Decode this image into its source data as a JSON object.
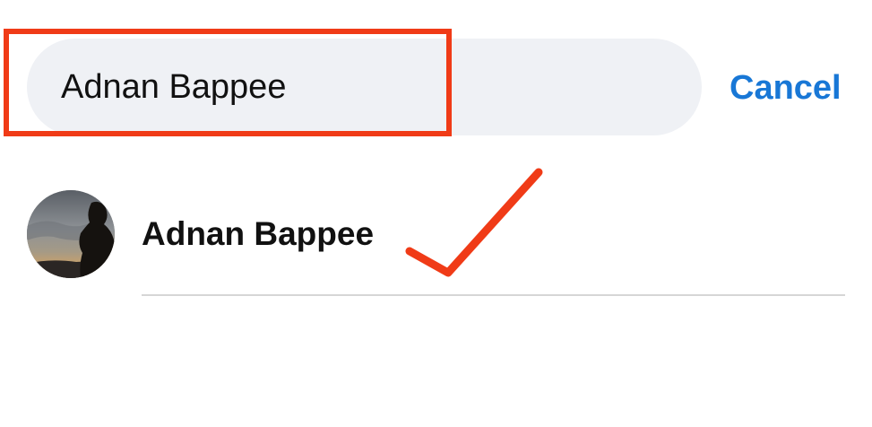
{
  "search": {
    "value": "Adnan Bappee"
  },
  "header": {
    "cancel_label": "Cancel"
  },
  "results": [
    {
      "name": "Adnan Bappee"
    }
  ],
  "colors": {
    "accent": "#1877d6",
    "annotation": "#f03b17",
    "search_bg": "#eff1f5",
    "divider": "#d6d6d6"
  },
  "icons": {
    "avatar": "profile-photo-silhouette",
    "annotation_mark": "checkmark-icon"
  }
}
